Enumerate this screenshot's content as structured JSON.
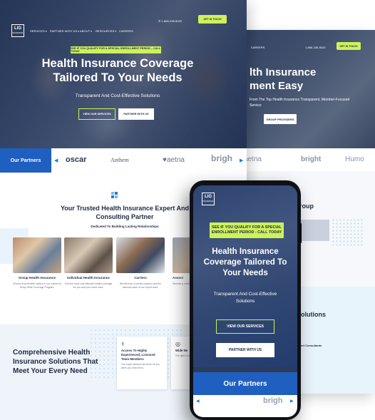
{
  "brand": {
    "logo": "LIG",
    "logo_sub": "INSURANCE"
  },
  "colors": {
    "primary_blue": "#1f5fc0",
    "accent_lime": "#cdf25a",
    "navy": "#1f2a44"
  },
  "desktop": {
    "nav": {
      "items": [
        "SERVICES",
        "PARTNER WITH US",
        "ABOUT",
        "RESOURCES",
        "CAREERS"
      ],
      "phone": "1-866-236-5020",
      "cta": "GET IN TOUCH"
    },
    "hero": {
      "banner": "SEE IF YOU QUALIFY FOR A SPECIAL ENROLLMENT PERIOD – CALL TODAY",
      "title_line1": "Health Insurance Coverage",
      "title_line2": "Tailored To Your Needs",
      "subtitle": "Transparent And Cost-Effective Solutions",
      "btn_services": "VIEW OUR SERVICES",
      "btn_partner": "PARTNER WITH US"
    },
    "partners": {
      "label": "Our Partners",
      "logos": [
        "oscar",
        "Anthem",
        "♥aetna",
        "brigh"
      ]
    },
    "trusted": {
      "title": "Your Trusted Health Insurance Expert And Consulting Partner",
      "subtitle": "Dedicated To Building Lasting Relationships"
    },
    "cards": [
      {
        "title": "Group Health Insurance",
        "desc": "Choose from flexible options in our custom-fit Group Wide Coverage Program."
      },
      {
        "title": "Individual Health Insurance",
        "desc": "Find the most cost-effective health coverage for you and your loved ones."
      },
      {
        "title": "Carriers",
        "desc": "Benefit from a turnkey solution and the national reach of our expert team."
      },
      {
        "title": "Associ",
        "desc": "Receive p concierge-Associatio"
      }
    ],
    "comprehensive": {
      "title": "Comprehensive Health Insurance Solutions That Meet Your Every Need"
    },
    "features": [
      {
        "icon": "⚕",
        "title": "Access To Highly Experienced, Licensed Team Members",
        "desc": "Our expert advisors are there for you when you need them."
      },
      {
        "icon": "◎",
        "title": "Wide Ne",
        "desc": "The right c a broad n"
      }
    ]
  },
  "back_page": {
    "nav": {
      "item": "CAREERS",
      "phone": "1-866-236-5020",
      "cta": "GET IN TOUCH"
    },
    "hero": {
      "title_line1": "lth Insurance",
      "title_line2": "ment Easy",
      "subtitle": "From The Top Health Insurance Transparent, Member-Focused Service",
      "btn": "GROUP PROVIDERS"
    },
    "logos": [
      "♥aetna",
      "bright",
      "Humo"
    ],
    "section_title": "roup",
    "solutions_title": "olutions",
    "expert": "ert Consultants"
  },
  "phone": {
    "banner": "SEE IF YOU QUALIFY FOR A SPECIAL ENROLLMENT PERIOD - CALL TODAY",
    "title": "Health Insurance Coverage Tailored To Your Needs",
    "subtitle": "Transparent And Cost-Effective Solutions",
    "btn_services": "VIEW OUR SERVICES",
    "btn_partner": "PARTNER WITH US",
    "partners_label": "Our Partners",
    "logo_partial": "brigh"
  }
}
